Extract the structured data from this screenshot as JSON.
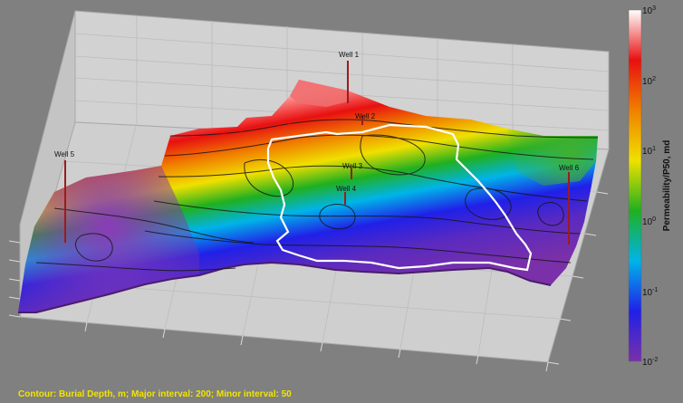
{
  "wells": [
    {
      "label": "Well 1"
    },
    {
      "label": "Well 2"
    },
    {
      "label": "Well 3"
    },
    {
      "label": "Well 4"
    },
    {
      "label": "Well 5"
    },
    {
      "label": "Well 6"
    }
  ],
  "colorbar": {
    "title": "Permeability/P50, md",
    "scale": "log",
    "range": [
      -2,
      3
    ],
    "ticks": [
      {
        "base": "10",
        "exp": "3"
      },
      {
        "base": "10",
        "exp": "2"
      },
      {
        "base": "10",
        "exp": "1"
      },
      {
        "base": "10",
        "exp": "0"
      },
      {
        "base": "10",
        "exp": "-1"
      },
      {
        "base": "10",
        "exp": "-2"
      }
    ],
    "colors": [
      "#7a30a8",
      "#2020e8",
      "#00b4e8",
      "#20b020",
      "#f0e000",
      "#f08000",
      "#e81010",
      "#ffffff"
    ]
  },
  "caption": "Contour:  Burial Depth, m;  Major interval: 200;  Minor interval: 50",
  "colors": {
    "background": "#808080",
    "box_face": "#d2d2d2",
    "box_edge": "#a9a9a9",
    "well_line": "#9b1c1c",
    "boundary": "#ffffff",
    "caption": "#f2e400"
  }
}
